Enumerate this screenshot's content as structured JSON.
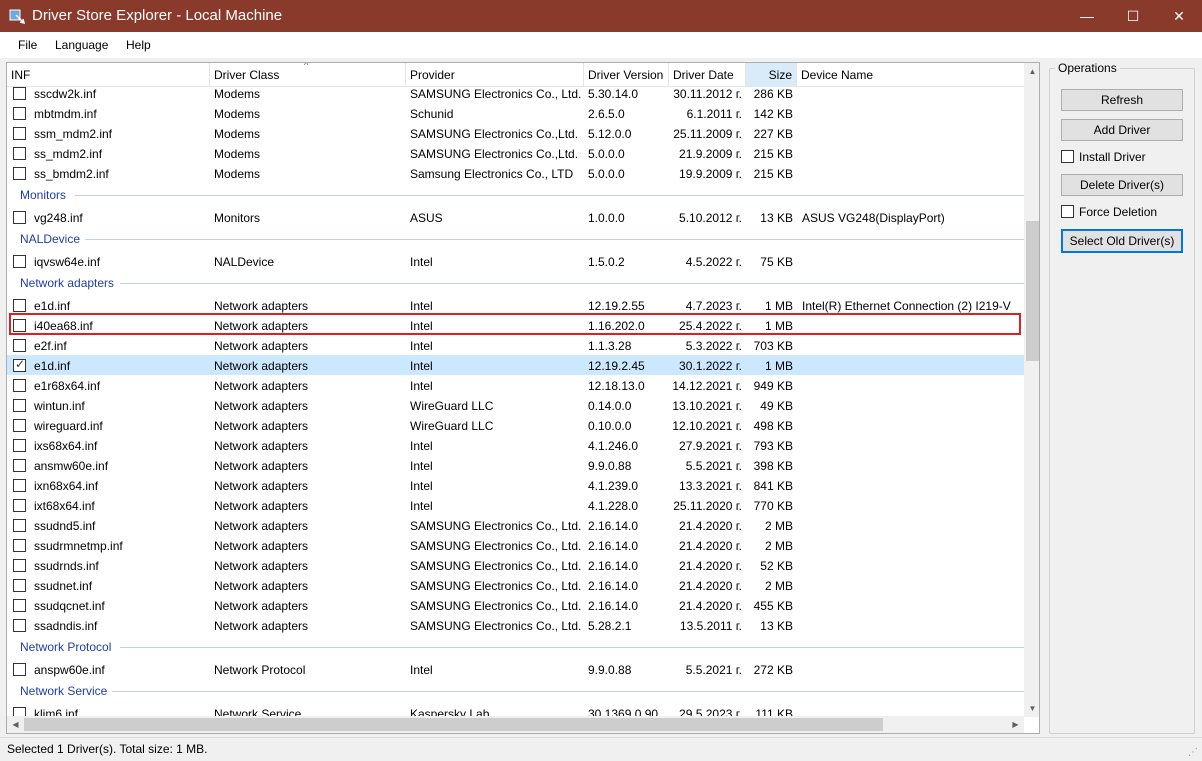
{
  "window": {
    "title": "Driver Store Explorer - Local Machine",
    "minimize_glyph": "—",
    "maximize_glyph": "☐",
    "close_glyph": "✕",
    "titlebar_color": "#8a3a2a"
  },
  "menu": [
    "File",
    "Language",
    "Help"
  ],
  "columns": [
    "INF",
    "Driver Class",
    "Provider",
    "Driver Version",
    "Driver Date",
    "Size",
    "Device Name"
  ],
  "sort_glyph": "^",
  "groups": {
    "monitors": "Monitors",
    "naldevice": "NALDevice",
    "network_adapters": "Network adapters",
    "network_protocol": "Network Protocol",
    "network_service": "Network Service"
  },
  "rows_top": [
    {
      "inf": "sscdw2k.inf",
      "cls": "Modems",
      "prov": "SAMSUNG Electronics Co., Ltd.",
      "ver": "5.30.14.0",
      "date": "30.11.2012 г.",
      "size": "286 KB",
      "dev": ""
    },
    {
      "inf": "mbtmdm.inf",
      "cls": "Modems",
      "prov": "Schunid",
      "ver": "2.6.5.0",
      "date": "6.1.2011 г.",
      "size": "142 KB",
      "dev": ""
    },
    {
      "inf": "ssm_mdm2.inf",
      "cls": "Modems",
      "prov": "SAMSUNG Electronics Co.,Ltd.",
      "ver": "5.12.0.0",
      "date": "25.11.2009 г.",
      "size": "227 KB",
      "dev": ""
    },
    {
      "inf": "ss_mdm2.inf",
      "cls": "Modems",
      "prov": "SAMSUNG Electronics Co.,Ltd.",
      "ver": "5.0.0.0",
      "date": "21.9.2009 г.",
      "size": "215 KB",
      "dev": ""
    },
    {
      "inf": "ss_bmdm2.inf",
      "cls": "Modems",
      "prov": "Samsung Electronics Co., LTD",
      "ver": "5.0.0.0",
      "date": "19.9.2009 г.",
      "size": "215 KB",
      "dev": ""
    }
  ],
  "rows_monitors": [
    {
      "inf": "vg248.inf",
      "cls": "Monitors",
      "prov": "ASUS",
      "ver": "1.0.0.0",
      "date": "5.10.2012 г.",
      "size": "13 KB",
      "dev": "ASUS VG248(DisplayPort)"
    }
  ],
  "rows_nal": [
    {
      "inf": "iqvsw64e.inf",
      "cls": "NALDevice",
      "prov": "Intel",
      "ver": "1.5.0.2",
      "date": "4.5.2022 г.",
      "size": "75 KB",
      "dev": ""
    }
  ],
  "rows_network": [
    {
      "inf": "e1d.inf",
      "cls": "Network adapters",
      "prov": "Intel",
      "ver": "12.19.2.55",
      "date": "4.7.2023 г.",
      "size": "1 MB",
      "dev": "Intel(R) Ethernet Connection (2) I219-V"
    },
    {
      "inf": "i40ea68.inf",
      "cls": "Network adapters",
      "prov": "Intel",
      "ver": "1.16.202.0",
      "date": "25.4.2022 г.",
      "size": "1 MB",
      "dev": ""
    },
    {
      "inf": "e2f.inf",
      "cls": "Network adapters",
      "prov": "Intel",
      "ver": "1.1.3.28",
      "date": "5.3.2022 г.",
      "size": "703 KB",
      "dev": ""
    },
    {
      "inf": "e1d.inf",
      "cls": "Network adapters",
      "prov": "Intel",
      "ver": "12.19.2.45",
      "date": "30.1.2022 г.",
      "size": "1 MB",
      "dev": "",
      "checked": true,
      "selected": true
    },
    {
      "inf": "e1r68x64.inf",
      "cls": "Network adapters",
      "prov": "Intel",
      "ver": "12.18.13.0",
      "date": "14.12.2021 г.",
      "size": "949 KB",
      "dev": ""
    },
    {
      "inf": "wintun.inf",
      "cls": "Network adapters",
      "prov": "WireGuard LLC",
      "ver": "0.14.0.0",
      "date": "13.10.2021 г.",
      "size": "49 KB",
      "dev": ""
    },
    {
      "inf": "wireguard.inf",
      "cls": "Network adapters",
      "prov": "WireGuard LLC",
      "ver": "0.10.0.0",
      "date": "12.10.2021 г.",
      "size": "498 KB",
      "dev": ""
    },
    {
      "inf": "ixs68x64.inf",
      "cls": "Network adapters",
      "prov": "Intel",
      "ver": "4.1.246.0",
      "date": "27.9.2021 г.",
      "size": "793 KB",
      "dev": ""
    },
    {
      "inf": "ansmw60e.inf",
      "cls": "Network adapters",
      "prov": "Intel",
      "ver": "9.9.0.88",
      "date": "5.5.2021 г.",
      "size": "398 KB",
      "dev": ""
    },
    {
      "inf": "ixn68x64.inf",
      "cls": "Network adapters",
      "prov": "Intel",
      "ver": "4.1.239.0",
      "date": "13.3.2021 г.",
      "size": "841 KB",
      "dev": ""
    },
    {
      "inf": "ixt68x64.inf",
      "cls": "Network adapters",
      "prov": "Intel",
      "ver": "4.1.228.0",
      "date": "25.11.2020 г.",
      "size": "770 KB",
      "dev": ""
    },
    {
      "inf": "ssudnd5.inf",
      "cls": "Network adapters",
      "prov": "SAMSUNG Electronics Co., Ltd.",
      "ver": "2.16.14.0",
      "date": "21.4.2020 г.",
      "size": "2 MB",
      "dev": ""
    },
    {
      "inf": "ssudrmnetmp.inf",
      "cls": "Network adapters",
      "prov": "SAMSUNG Electronics Co., Ltd.",
      "ver": "2.16.14.0",
      "date": "21.4.2020 г.",
      "size": "2 MB",
      "dev": ""
    },
    {
      "inf": "ssudrnds.inf",
      "cls": "Network adapters",
      "prov": "SAMSUNG Electronics Co., Ltd.",
      "ver": "2.16.14.0",
      "date": "21.4.2020 г.",
      "size": "52 KB",
      "dev": ""
    },
    {
      "inf": "ssudnet.inf",
      "cls": "Network adapters",
      "prov": "SAMSUNG Electronics Co., Ltd.",
      "ver": "2.16.14.0",
      "date": "21.4.2020 г.",
      "size": "2 MB",
      "dev": ""
    },
    {
      "inf": "ssudqcnet.inf",
      "cls": "Network adapters",
      "prov": "SAMSUNG Electronics Co., Ltd.",
      "ver": "2.16.14.0",
      "date": "21.4.2020 г.",
      "size": "455 KB",
      "dev": ""
    },
    {
      "inf": "ssadndis.inf",
      "cls": "Network adapters",
      "prov": "SAMSUNG Electronics Co., Ltd.",
      "ver": "5.28.2.1",
      "date": "13.5.2011 г.",
      "size": "13 KB",
      "dev": ""
    }
  ],
  "rows_protocol": [
    {
      "inf": "anspw60e.inf",
      "cls": "Network Protocol",
      "prov": "Intel",
      "ver": "9.9.0.88",
      "date": "5.5.2021 г.",
      "size": "272 KB",
      "dev": ""
    }
  ],
  "rows_service": [
    {
      "inf": "klim6.inf",
      "cls": "Network Service",
      "prov": "Kaspersky Lab",
      "ver": "30.1369.0.90",
      "date": "29.5.2023 г.",
      "size": "111 KB",
      "dev": ""
    }
  ],
  "operations": {
    "title": "Operations",
    "refresh": "Refresh",
    "add_driver": "Add Driver",
    "install_driver": "Install Driver",
    "delete_drivers": "Delete Driver(s)",
    "force_deletion": "Force Deletion",
    "select_old": "Select Old Driver(s)"
  },
  "status": "Selected 1 Driver(s). Total size: 1 MB.",
  "colors": {
    "group_header": "#1e3ea8",
    "selected_row": "#cce8ff",
    "highlight_box": "#e02020"
  }
}
